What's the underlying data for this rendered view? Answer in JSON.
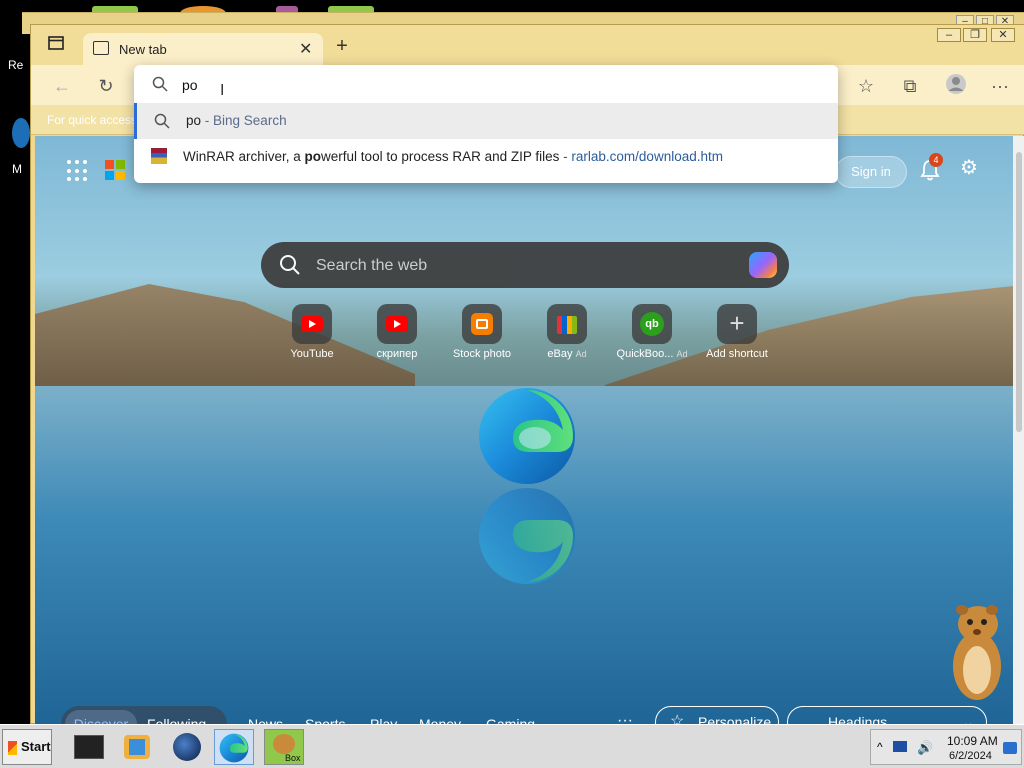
{
  "desktop": {
    "left_text_1": "Re",
    "left_text_2": "M"
  },
  "browser": {
    "tab_title": "New tab",
    "tab_close": "✕",
    "new_tab": "+",
    "favorites_bar_text": "For quick access",
    "address": {
      "value": "po"
    },
    "suggestions": [
      {
        "bold": "po",
        "rest": " - Bing Search"
      },
      {
        "pre": "WinRAR archiver, a ",
        "bold": "po",
        "mid": "werful tool to process RAR and ZIP files",
        "url": " - rarlab.com/download.htm"
      }
    ],
    "more_label": "···"
  },
  "newtab": {
    "signin": "Sign in",
    "notif_count": "4",
    "search_placeholder": "Search the web",
    "shortcuts": [
      {
        "label": "YouTube",
        "ad": ""
      },
      {
        "label": "скрипер",
        "ad": ""
      },
      {
        "label": "Stock photo",
        "ad": ""
      },
      {
        "label": "eBay",
        "ad": "Ad"
      },
      {
        "label": "QuickBoo...",
        "ad": "Ad"
      },
      {
        "label": "Add shortcut",
        "ad": ""
      }
    ],
    "nav": {
      "discover": "Discover",
      "following": "Following",
      "news": "News",
      "sports": "Sports",
      "play": "Play",
      "money": "Money",
      "gaming": "Gaming",
      "more": "···",
      "personalize": "Personalize",
      "headings": "Headings"
    }
  },
  "taskbar": {
    "start": "Start",
    "time": "10:09 AM",
    "date": "6/2/2024",
    "tray_chevron": "^",
    "box_label": "Box"
  },
  "colors": {
    "accent": "#2b6cd9",
    "window_frame": "#f0d890",
    "badge": "#d9461c"
  }
}
